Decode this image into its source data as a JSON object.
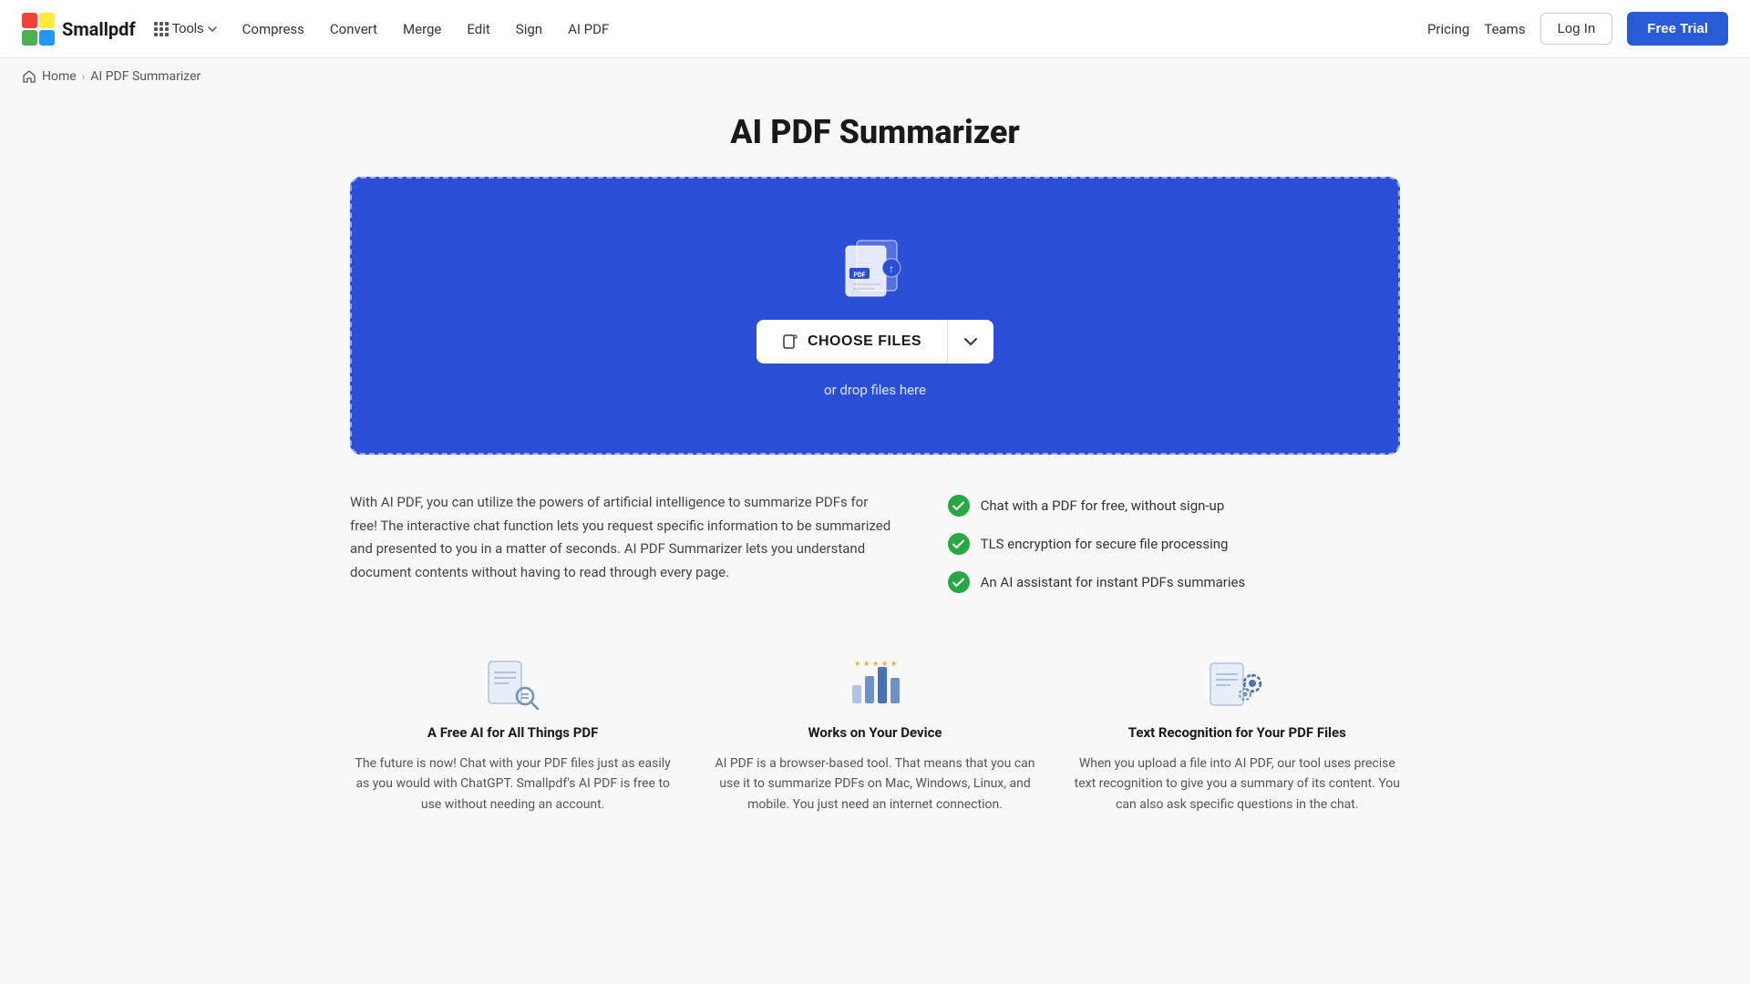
{
  "logo": {
    "text": "Smallpdf"
  },
  "nav": {
    "tools_label": "Tools",
    "items": [
      {
        "id": "compress",
        "label": "Compress"
      },
      {
        "id": "convert",
        "label": "Convert"
      },
      {
        "id": "merge",
        "label": "Merge"
      },
      {
        "id": "edit",
        "label": "Edit"
      },
      {
        "id": "sign",
        "label": "Sign"
      },
      {
        "id": "ai-pdf",
        "label": "AI PDF"
      }
    ],
    "pricing": "Pricing",
    "teams": "Teams",
    "login": "Log In",
    "free_trial": "Free Trial"
  },
  "breadcrumb": {
    "home": "Home",
    "current": "AI PDF Summarizer"
  },
  "page": {
    "title": "AI PDF Summarizer"
  },
  "drop_zone": {
    "choose_files": "CHOOSE FILES",
    "drop_hint": "or drop files here"
  },
  "feature_description": "With AI PDF, you can utilize the powers of artificial intelligence to summarize PDFs for free! The interactive chat function lets you request specific information to be summarized and presented to you in a matter of seconds. AI PDF Summarizer lets you understand document contents without having to read through every page.",
  "feature_list": [
    "Chat with a PDF for free, without sign-up",
    "TLS encryption for secure file processing",
    "An AI assistant for instant PDFs summaries"
  ],
  "cards": [
    {
      "id": "free-ai",
      "title": "A Free AI for All Things PDF",
      "desc": "The future is now! Chat with your PDF files just as easily as you would with ChatGPT. Smallpdf's AI PDF is free to use without needing an account."
    },
    {
      "id": "works-device",
      "title": "Works on Your Device",
      "desc": "AI PDF is a browser-based tool. That means that you can use it to summarize PDFs on Mac, Windows, Linux, and mobile. You just need an internet connection."
    },
    {
      "id": "text-recognition",
      "title": "Text Recognition for Your PDF Files",
      "desc": "When you upload a file into AI PDF, our tool uses precise text recognition to give you a summary of its content. You can also ask specific questions in the chat."
    }
  ],
  "colors": {
    "brand_blue": "#2a4fd6",
    "button_blue": "#2a5bd7",
    "green": "#28a745"
  }
}
